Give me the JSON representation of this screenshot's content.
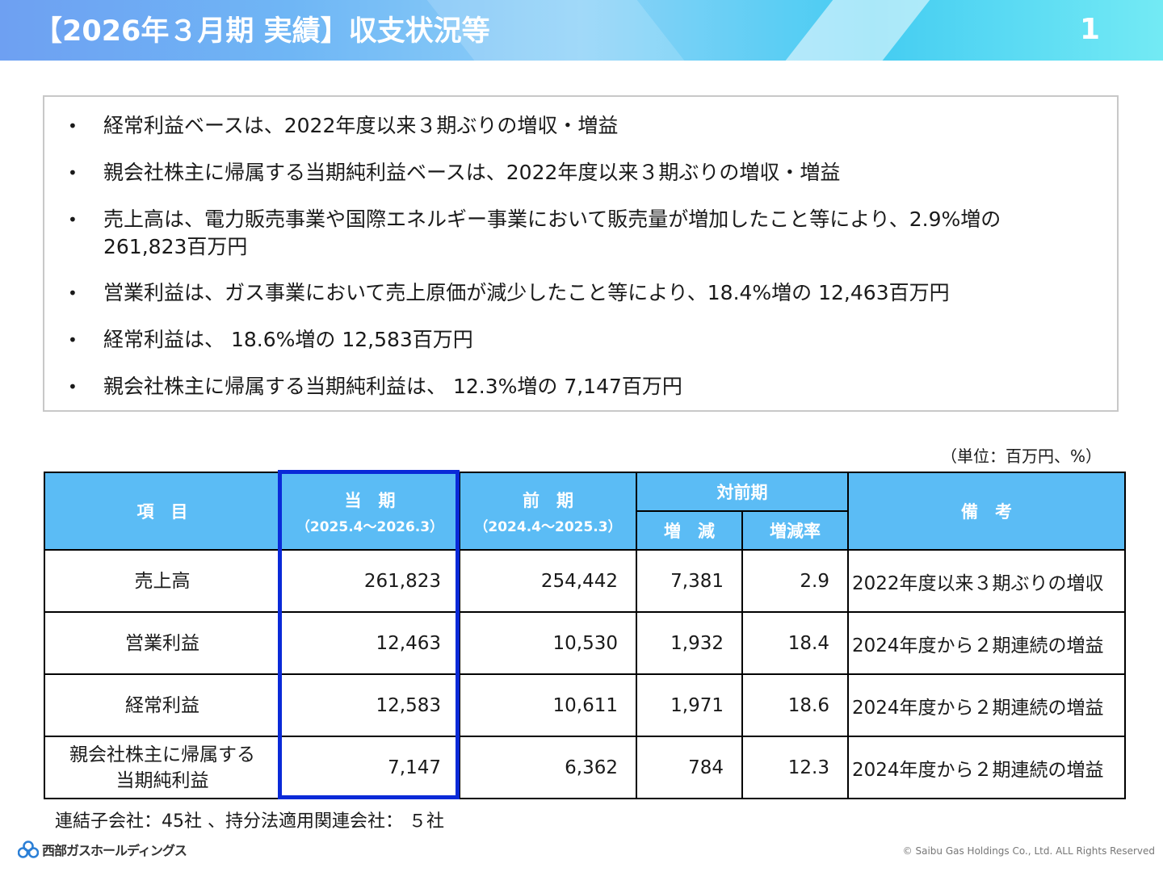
{
  "header": {
    "title": "【2026年３月期 実績】収支状況等",
    "page_number": "1"
  },
  "summary": {
    "bullets": [
      "経常利益ベースは、2022年度以来３期ぶりの増収・増益",
      "親会社株主に帰属する当期純利益ベースは、2022年度以来３期ぶりの増収・増益",
      "売上高は、電力販売事業や国際エネルギー事業において販売量が増加したこと等により、2.9%増の 261,823百万円",
      "営業利益は、ガス事業において売上原価が減少したこと等により、18.4%増の 12,463百万円",
      "経常利益は、 18.6%増の 12,583百万円",
      "親会社株主に帰属する当期純利益は、 12.3%増の 7,147百万円"
    ]
  },
  "table": {
    "unit": "（単位：百万円、%）",
    "headers": {
      "item": "項　目",
      "current": "当　期",
      "current_period": "（2025.4～2026.3）",
      "prior": "前　期",
      "prior_period": "（2024.4～2025.3）",
      "yoy": "対前期",
      "change": "増　減",
      "change_rate": "増減率",
      "remarks": "備　考"
    },
    "rows": [
      {
        "item_line1": "売上高",
        "item_line2": "",
        "current": "261,823",
        "prior": "254,442",
        "change": "7,381",
        "rate": "2.9",
        "remarks": "2022年度以来３期ぶりの増収"
      },
      {
        "item_line1": "営業利益",
        "item_line2": "",
        "current": "12,463",
        "prior": "10,530",
        "change": "1,932",
        "rate": "18.4",
        "remarks": "2024年度から２期連続の増益"
      },
      {
        "item_line1": "経常利益",
        "item_line2": "",
        "current": "12,583",
        "prior": "10,611",
        "change": "1,971",
        "rate": "18.6",
        "remarks": "2024年度から２期連続の増益"
      },
      {
        "item_line1": "親会社株主に帰属する",
        "item_line2": "当期純利益",
        "current": "7,147",
        "prior": "6,362",
        "change": "784",
        "rate": "12.3",
        "remarks": "2024年度から２期連続の増益"
      }
    ]
  },
  "footnote": "連結子会社：45社 、持分法適用関連会社： ５社",
  "footer": {
    "logo_text": "西部ガスホールディングス",
    "copyright": "© Saibu Gas Holdings Co., Ltd. ALL Rights Reserved"
  },
  "colors": {
    "header_accent": "#5bbcf5",
    "highlight_border": "#0a2ad8"
  }
}
